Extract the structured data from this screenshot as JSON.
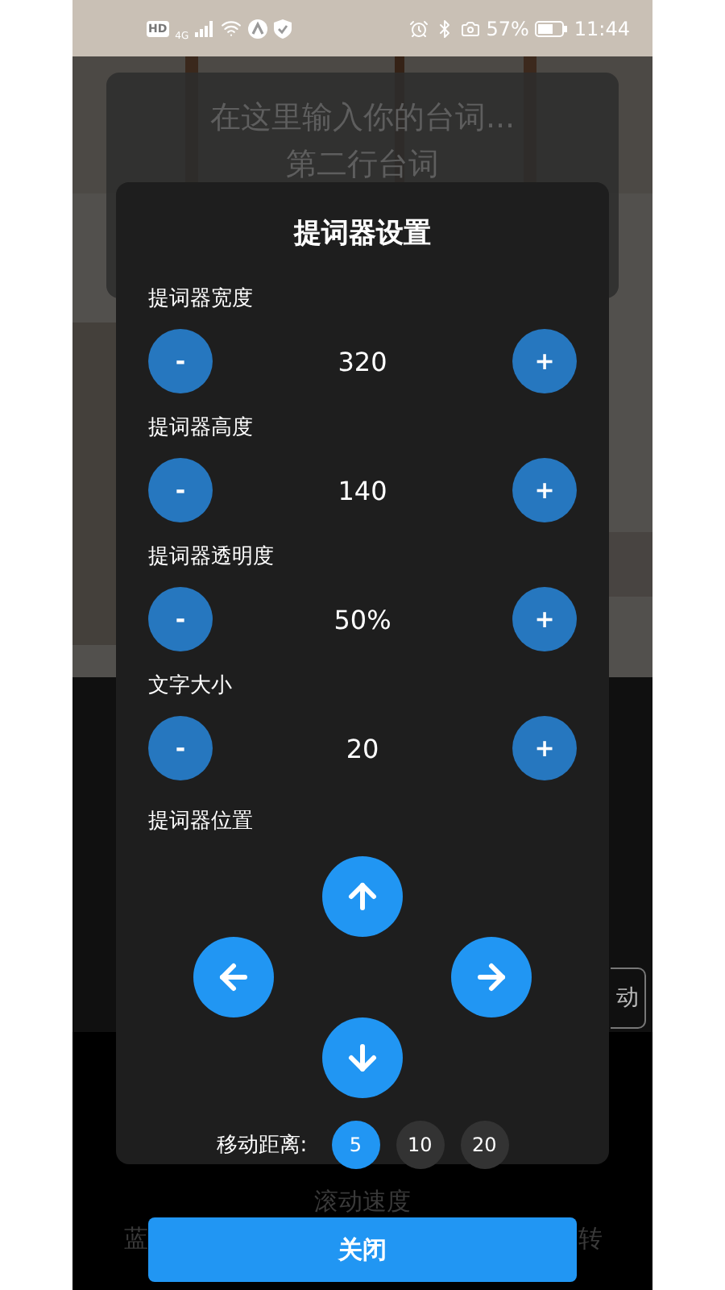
{
  "status_bar": {
    "badges": [
      "HD",
      "4G"
    ],
    "battery": "57%",
    "time": "11:44"
  },
  "teleprompter": {
    "lines": [
      "在这里输入你的台词...",
      "第二行台词"
    ]
  },
  "background_controls": {
    "side_button": "动",
    "speed_label": "滚动速度",
    "left_label": "蓝",
    "right_label": "转"
  },
  "dialog": {
    "title": "提词器设置",
    "steppers": [
      {
        "label": "提词器宽度",
        "value": "320",
        "minus": "-",
        "plus": "+"
      },
      {
        "label": "提词器高度",
        "value": "140",
        "minus": "-",
        "plus": "+"
      },
      {
        "label": "提词器透明度",
        "value": "50%",
        "minus": "-",
        "plus": "+"
      },
      {
        "label": "文字大小",
        "value": "20",
        "minus": "-",
        "plus": "+"
      }
    ],
    "position": {
      "label": "提词器位置",
      "arrows": [
        {
          "kind": "up"
        },
        {
          "kind": "left"
        },
        {
          "kind": "right"
        },
        {
          "kind": "down"
        }
      ]
    },
    "distance": {
      "label": "移动距离:",
      "options": [
        {
          "label": "5",
          "selected": true
        },
        {
          "label": "10",
          "selected": false
        },
        {
          "label": "20",
          "selected": false
        }
      ]
    }
  },
  "close_button": "关闭"
}
